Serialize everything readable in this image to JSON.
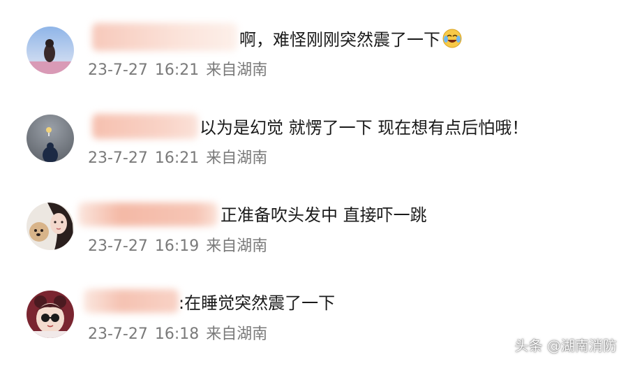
{
  "comments": [
    {
      "text": "啊，难怪刚刚突然震了一下",
      "emoji": "laughing-crying-emoji",
      "date": "23-7-27",
      "time": "16:21",
      "source": "来自湖南"
    },
    {
      "text": "以为是幻觉 就愣了一下 现在想有点后怕哦！",
      "date": "23-7-27",
      "time": "16:21",
      "source": "来自湖南"
    },
    {
      "text": "正准备吹头发中 直接吓一跳",
      "date": "23-7-27",
      "time": "16:19",
      "source": "来自湖南"
    },
    {
      "text": ":在睡觉突然震了一下",
      "date": "23-7-27",
      "time": "16:18",
      "source": "来自湖南"
    }
  ],
  "watermark": "头条 @湖南消防",
  "colors": {
    "redaction": "#f5c2b2",
    "meta_text": "#7a7a7a",
    "comment_text": "#1a1a1a"
  }
}
